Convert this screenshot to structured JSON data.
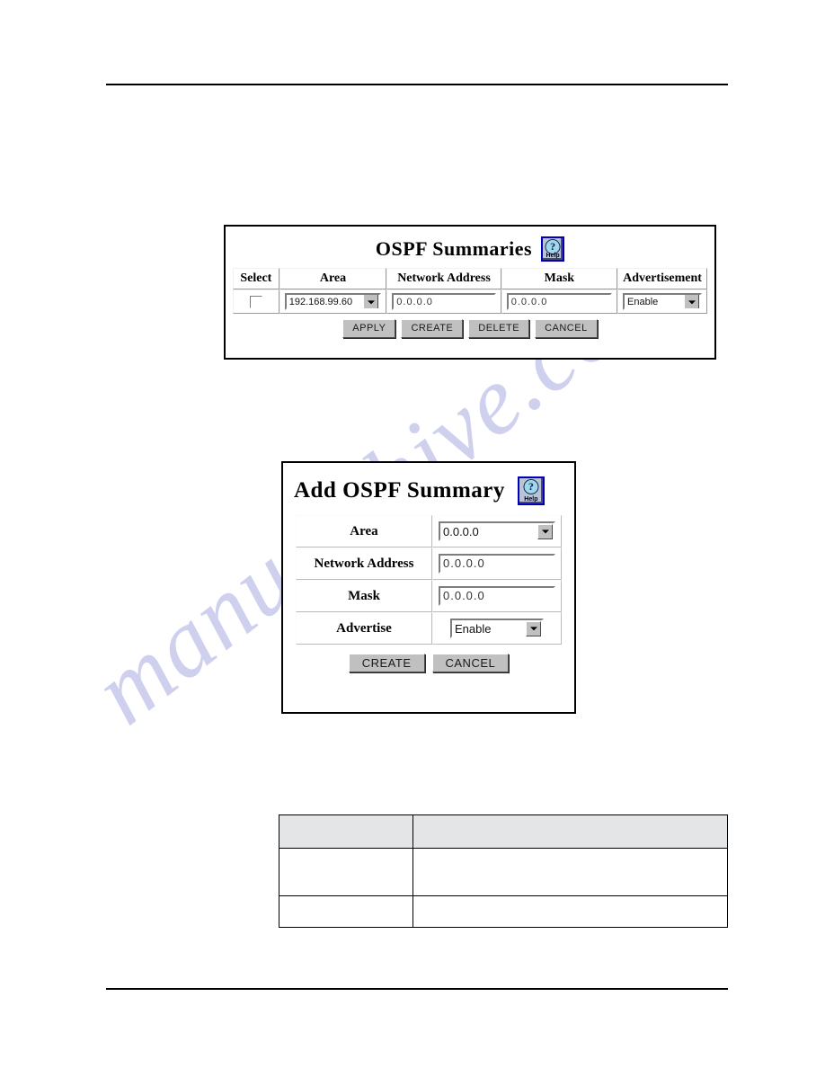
{
  "document": {
    "watermark_text": "manualshive.com",
    "watermark_color": "#c7c8ec",
    "rules": {
      "top": true,
      "bottom": true
    }
  },
  "summaries_panel": {
    "title": "OSPF Summaries",
    "help_button": {
      "icon": "question-mark-icon",
      "label": "Help",
      "glyph": "?"
    },
    "columns": [
      "Select",
      "Area",
      "Network Address",
      "Mask",
      "Advertisement"
    ],
    "row": {
      "select_checked": false,
      "area_value": "192.168.99.60",
      "network_address_value": "0.0.0.0",
      "mask_value": "0.0.0.0",
      "advertisement_value": "Enable"
    },
    "buttons": [
      "APPLY",
      "CREATE",
      "DELETE",
      "CANCEL"
    ]
  },
  "add_panel": {
    "title": "Add OSPF Summary",
    "help_button": {
      "icon": "question-mark-icon",
      "label": "Help",
      "glyph": "?"
    },
    "fields": [
      {
        "label": "Area",
        "value": "0.0.0.0",
        "control": "dropdown"
      },
      {
        "label": "Network Address",
        "value": "0.0.0.0",
        "control": "textbox"
      },
      {
        "label": "Mask",
        "value": "0.0.0.0",
        "control": "textbox"
      },
      {
        "label": "Advertise",
        "value": "Enable",
        "control": "dropdown"
      }
    ],
    "buttons": [
      "CREATE",
      "CANCEL"
    ]
  },
  "description_table": {
    "headers": [
      "",
      ""
    ],
    "rows": [
      [
        "",
        ""
      ],
      [
        "",
        ""
      ]
    ]
  }
}
